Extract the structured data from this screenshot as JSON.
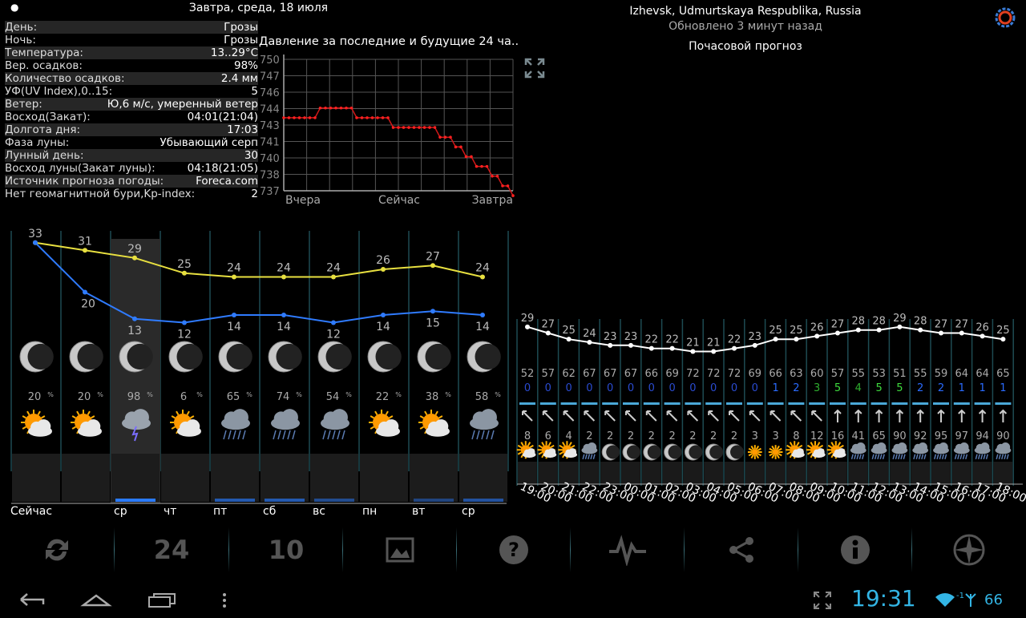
{
  "header": {
    "date": "Завтра, среда, 18 июля",
    "bullet": "●"
  },
  "info": [
    {
      "k": "День:",
      "v": "Грозы"
    },
    {
      "k": "Ночь:",
      "v": "Грозы"
    },
    {
      "k": "Температура:",
      "v": "13..29°C"
    },
    {
      "k": "Вер. осадков:",
      "v": "98%"
    },
    {
      "k": "Количество осадков:",
      "v": "2.4 мм"
    },
    {
      "k": "УФ(UV Index),0..15:",
      "v": "5"
    },
    {
      "k": "Ветер:",
      "v": "Ю,6 м/с, умеренный ветер"
    },
    {
      "k": "Восход(Закат):",
      "v": "04:01(21:04)"
    },
    {
      "k": "Долгота дня:",
      "v": "17:03"
    },
    {
      "k": "Фаза луны:",
      "v": "Убывающий серп"
    },
    {
      "k": "Лунный день:",
      "v": "30"
    },
    {
      "k": "Восход луны(Закат луны):",
      "v": "04:18(21:05)"
    },
    {
      "k": "Источник прогноза погоды:",
      "v": "Foreca.com"
    },
    {
      "k": "Нет геомагнитной бури,Kp-index:",
      "v": "2"
    }
  ],
  "location": {
    "name": "Izhevsk, Udmurtskaya Respublika, Russia",
    "updated": "Обновлено 3 минут назад"
  },
  "hourly_title": "Почасовой прогноз",
  "pressure": {
    "title": "Давление за последние и будущие 24 ча..",
    "y_ticks": [
      "750",
      "747",
      "746",
      "744",
      "743",
      "741",
      "740",
      "738",
      "737"
    ],
    "x_labels": [
      "Вчера",
      "Сейчас",
      "Завтра"
    ],
    "values": [
      744,
      744,
      744,
      744,
      744,
      744,
      744,
      745,
      745,
      745,
      745,
      745,
      745,
      745,
      744,
      744,
      744,
      744,
      744,
      744,
      744,
      743,
      743,
      743,
      743,
      743,
      743,
      743,
      743,
      743,
      742,
      742,
      742,
      741,
      741,
      740,
      740,
      739,
      739,
      739,
      738,
      738,
      737,
      737,
      736
    ]
  },
  "daily": {
    "days": [
      "Сейчас",
      "ср",
      "чт",
      "пт",
      "сб",
      "вс",
      "пн",
      "вт",
      "ср"
    ],
    "hi": [
      33,
      31,
      29,
      25,
      24,
      24,
      24,
      26,
      27,
      24
    ],
    "lo": [
      33,
      20,
      13,
      12,
      14,
      14,
      12,
      14,
      15,
      14
    ],
    "hi_labels": [
      "33",
      "31",
      "29",
      "25",
      "24",
      "24",
      "24",
      "26",
      "27",
      "24"
    ],
    "lo_labels": [
      "",
      "20",
      "13",
      "12",
      "14",
      "14",
      "12",
      "14",
      "15",
      "14"
    ],
    "precip": [
      "20",
      "20",
      "98",
      "6",
      "65",
      "74",
      "54",
      "22",
      "38",
      "58"
    ],
    "icons": [
      "partly-sunny-icon",
      "partly-sunny-icon",
      "thunderstorm-icon",
      "partly-sunny-icon",
      "rain-icon",
      "rain-icon",
      "rain-icon",
      "partly-sunny-icon",
      "partly-sunny-icon",
      "rain-icon"
    ],
    "precip_amount": [
      0,
      0,
      1,
      0,
      0.5,
      0.5,
      0.3,
      0,
      0.2,
      0.4
    ],
    "colors": {
      "hi": "#e8e040",
      "lo": "#2f7bff"
    }
  },
  "hourly": {
    "temps": [
      29,
      27,
      25,
      24,
      23,
      23,
      22,
      22,
      21,
      21,
      22,
      23,
      25,
      25,
      26,
      27,
      28,
      28,
      29,
      28,
      27,
      27,
      26,
      25
    ],
    "humidity": [
      "52",
      "57",
      "62",
      "67",
      "67",
      "67",
      "66",
      "69",
      "72",
      "72",
      "72",
      "69",
      "66",
      "63",
      "60",
      "57",
      "55",
      "53",
      "51",
      "55",
      "59",
      "64",
      "64",
      "65"
    ],
    "uv": [
      "0",
      "0",
      "0",
      "0",
      "0",
      "0",
      "0",
      "0",
      "0",
      "0",
      "0",
      "0",
      "1",
      "2",
      "3",
      "5",
      "4",
      "5",
      "5",
      "2",
      "2",
      "1",
      "1",
      "1"
    ],
    "precip": [
      "8",
      "6",
      "4",
      "2",
      "2",
      "2",
      "2",
      "2",
      "2",
      "2",
      "2",
      "3",
      "3",
      "8",
      "12",
      "16",
      "41",
      "65",
      "90",
      "92",
      "95",
      "97",
      "94",
      "90"
    ],
    "times": [
      "19:00",
      "20:00",
      "21:00",
      "22:00",
      "23:00",
      "00:00",
      "01:00",
      "02:00",
      "03:00",
      "04:00",
      "05:00",
      "06:00",
      "07:00",
      "08:00",
      "09:00",
      "10:00",
      "11:00",
      "12:00",
      "13:00",
      "14:00",
      "15:00",
      "16:00",
      "17:00",
      "18:00"
    ]
  },
  "toolbar": {
    "label_24": "24",
    "label_10": "10"
  },
  "status": {
    "time": "19:31",
    "battery": "66",
    "signal": "-1"
  }
}
